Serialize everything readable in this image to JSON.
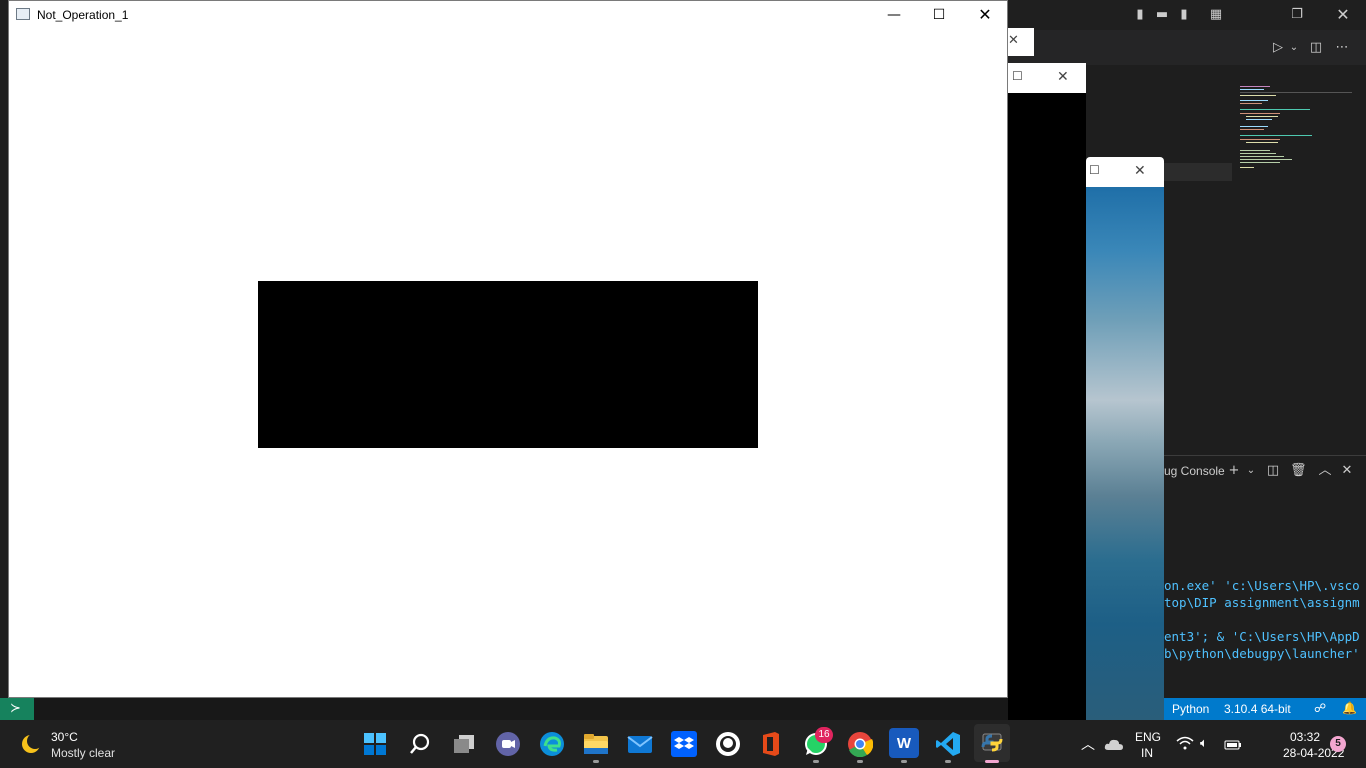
{
  "main_window": {
    "title": "Not_Operation_1",
    "minimize_glyph": "—",
    "maximize_glyph": "☐",
    "close_glyph": "✕"
  },
  "secondary_windows": {
    "close_glyph": "✕",
    "maximize_glyph": "☐"
  },
  "vscode": {
    "panel_title": "ug Console",
    "terminal_lines": [
      {
        "a": "on.exe' 'c:\\Users\\HP\\.vsco",
        "b": ""
      },
      {
        "a": "top\\DIP assignment\\assignm",
        "b": ""
      },
      {
        "a": "ent3'; & 'C:\\Users\\HP\\AppD",
        "b": ""
      },
      {
        "a": "b\\python\\debugpy\\launcher'",
        "b": ""
      }
    ],
    "status_language": "Python",
    "status_interpreter": "3.10.4 64-bit"
  },
  "taskbar": {
    "weather_temp": "30°C",
    "weather_desc": "Mostly clear",
    "apps": [
      {
        "name": "start-button",
        "label": "",
        "color": "#0078d4"
      },
      {
        "name": "search-button",
        "label": "",
        "color": "transparent"
      },
      {
        "name": "task-view-button",
        "label": "",
        "color": "transparent"
      },
      {
        "name": "teams-chat-button",
        "label": "",
        "color": "#5b5fc7"
      },
      {
        "name": "edge-button",
        "label": "",
        "color": "#0c8ed9"
      },
      {
        "name": "file-explorer-button",
        "label": "",
        "color": "#f3c44a"
      },
      {
        "name": "mail-button",
        "label": "",
        "color": "#0f78d4"
      },
      {
        "name": "dropbox-button",
        "label": "",
        "color": "#0061fe"
      },
      {
        "name": "github-button",
        "label": "",
        "color": "#ffffff"
      },
      {
        "name": "office-button",
        "label": "",
        "color": "#e64a19"
      },
      {
        "name": "whatsapp-button",
        "label": "",
        "color": "#25d366"
      },
      {
        "name": "chrome-button",
        "label": "",
        "color": "#e8453c"
      },
      {
        "name": "word-button",
        "label": "W",
        "color": "#185abd"
      },
      {
        "name": "vscode-button",
        "label": "",
        "color": "#0078d4"
      },
      {
        "name": "python-button",
        "label": "",
        "color": "#3776ab"
      }
    ],
    "whatsapp_badge": "16",
    "language": "ENG",
    "region": "IN",
    "time": "03:32",
    "date": "28-04-2022",
    "notification_count": "5"
  }
}
